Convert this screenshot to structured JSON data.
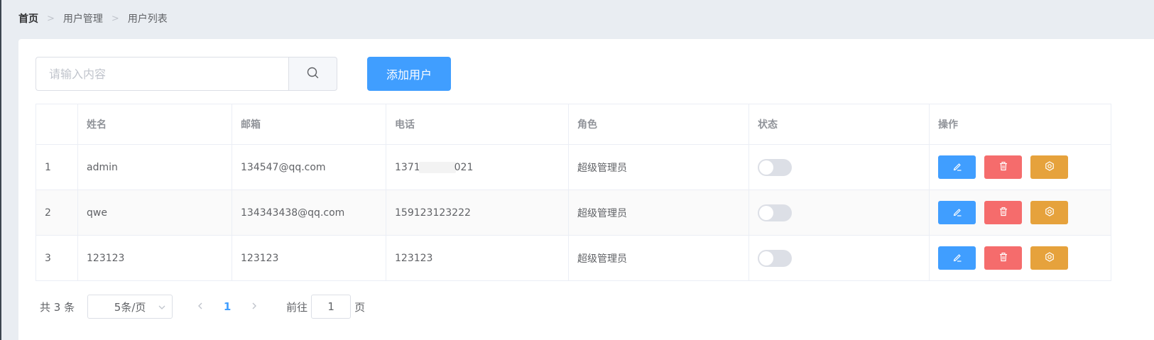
{
  "breadcrumb": {
    "home": "首页",
    "section": "用户管理",
    "page": "用户列表"
  },
  "search": {
    "placeholder": "请输入内容",
    "value": "",
    "icon": "search-icon"
  },
  "toolbar": {
    "add_label": "添加用户"
  },
  "table": {
    "columns": [
      "",
      "姓名",
      "邮箱",
      "电话",
      "角色",
      "状态",
      "操作"
    ],
    "rows": [
      {
        "index": "1",
        "name": "admin",
        "email": "134547@qq.com",
        "phone_start": "1371",
        "phone_end": "021",
        "role": "超级管理员",
        "status_on": false
      },
      {
        "index": "2",
        "name": "qwe",
        "email": "134343438@qq.com",
        "phone": "159123123222",
        "role": "超级管理员",
        "status_on": false
      },
      {
        "index": "3",
        "name": "123123",
        "email": "123123",
        "phone": "123123",
        "role": "超级管理员",
        "status_on": false
      }
    ],
    "actions": [
      {
        "name": "edit",
        "icon": "pencil-icon",
        "color": "#409eff"
      },
      {
        "name": "delete",
        "icon": "trash-icon",
        "color": "#f56c6c"
      },
      {
        "name": "settings",
        "icon": "gear-icon",
        "color": "#e6a23c"
      }
    ]
  },
  "pagination": {
    "total_label": "共 3 条",
    "page_size": "5条/页",
    "current_page": "1",
    "goto_label": "前往",
    "goto_value": "1",
    "goto_suffix": "页"
  },
  "colors": {
    "primary": "#409eff",
    "danger": "#f56c6c",
    "warning": "#e6a23c",
    "page_bg": "#e9edf2"
  }
}
